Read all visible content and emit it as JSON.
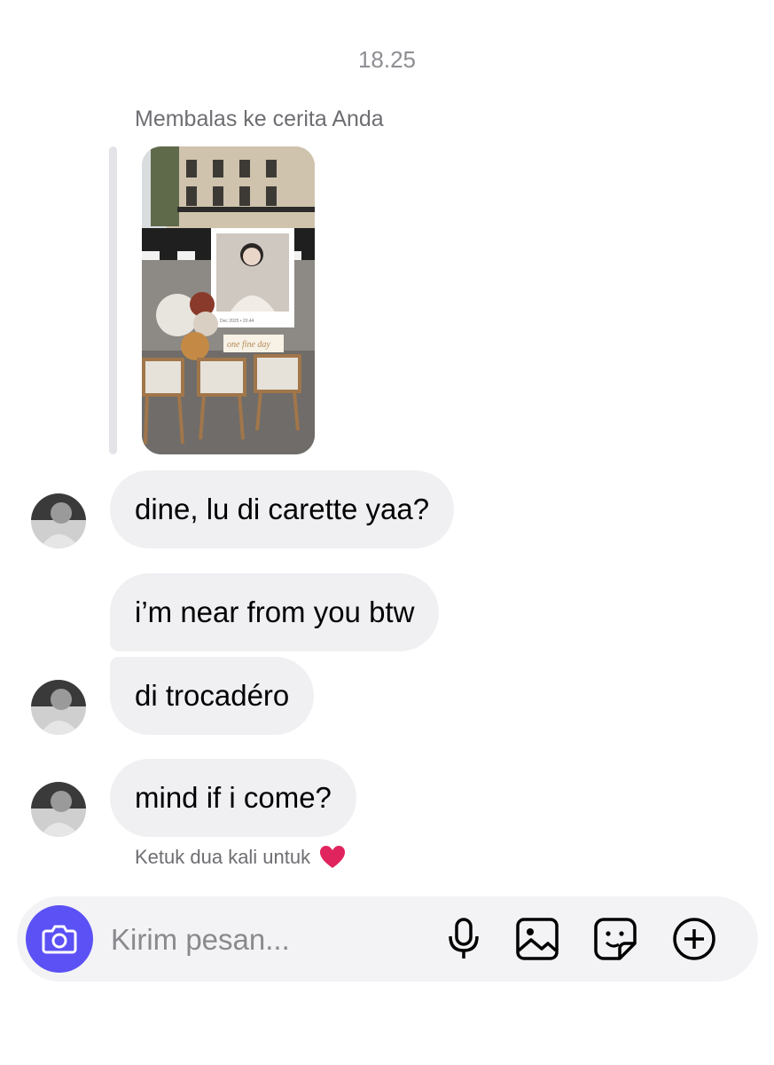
{
  "header": {
    "timestamp": "18.25"
  },
  "story_reply": {
    "context_label": "Membalas ke cerita Anda",
    "story_image": {
      "icon": "story-thumbnail",
      "caption_small": "Dec 2025 • 20.44",
      "caption_script": "one fine day"
    }
  },
  "messages": [
    {
      "text": "dine, lu di carette yaa?",
      "avatar": true
    },
    {
      "text": "i’m near from you btw",
      "avatar": false
    },
    {
      "text": "di trocadéro",
      "avatar": true
    },
    {
      "text": "mind if i come?",
      "avatar": true
    }
  ],
  "hint": {
    "text": "Ketuk dua kali untuk",
    "icon": "heart-icon",
    "color": "#e0245e"
  },
  "composer": {
    "placeholder": "Kirim pesan...",
    "camera_color": "#5b51f5",
    "icons": [
      "camera-icon",
      "microphone-icon",
      "gallery-icon",
      "sticker-icon",
      "plus-icon"
    ]
  }
}
